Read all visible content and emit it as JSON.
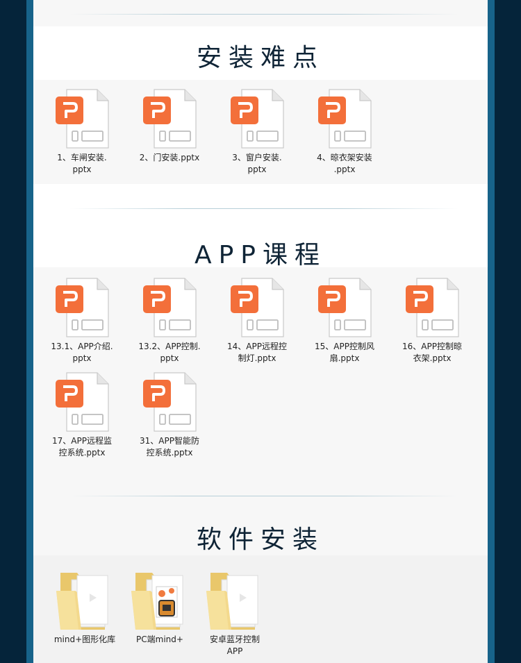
{
  "sections": [
    {
      "title": "安装难点",
      "files": [
        {
          "name": "1、车闸安装.\npptx",
          "type": "pptx"
        },
        {
          "name": "2、门安装.pptx",
          "type": "pptx"
        },
        {
          "name": "3、窗户安装.\npptx",
          "type": "pptx"
        },
        {
          "name": "4、晾衣架安装\n.pptx",
          "type": "pptx"
        }
      ]
    },
    {
      "title": "APP课程",
      "files": [
        {
          "name": "13.1、APP介绍.\npptx",
          "type": "pptx"
        },
        {
          "name": "13.2、APP控制.\npptx",
          "type": "pptx"
        },
        {
          "name": "14、APP远程控\n制灯.pptx",
          "type": "pptx"
        },
        {
          "name": "15、APP控制风\n扇.pptx",
          "type": "pptx"
        },
        {
          "name": "16、APP控制晾\n衣架.pptx",
          "type": "pptx"
        },
        {
          "name": "17、APP远程监\n控系统.pptx",
          "type": "pptx"
        },
        {
          "name": "31、APP智能防\n控系统.pptx",
          "type": "pptx"
        }
      ]
    },
    {
      "title": "软件安装",
      "files": [
        {
          "name": "mind+图形化库",
          "type": "folder"
        },
        {
          "name": "PC端mind+",
          "type": "folder-app"
        },
        {
          "name": "安卓蓝牙控制\nAPP",
          "type": "folder"
        }
      ]
    }
  ],
  "colors": {
    "background": "#05243a",
    "frame": "#17638a",
    "ppt_orange": "#f36f3a",
    "heading": "#0f2436"
  },
  "icons": {
    "pptx": "powerpoint-file-icon",
    "folder": "folder-icon"
  }
}
